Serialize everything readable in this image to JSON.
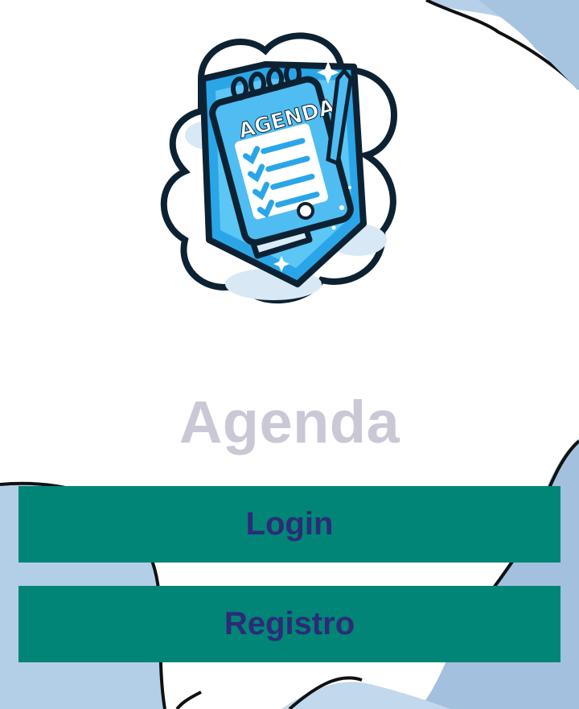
{
  "logo": {
    "text": "AGENDA",
    "icon": "agenda-notepad-logo"
  },
  "app": {
    "title": "Agenda"
  },
  "buttons": {
    "login_label": "Login",
    "register_label": "Registro"
  },
  "colors": {
    "background": "#ffffff",
    "blob": "#a9c8e4",
    "title": "#cbc8d6",
    "button_bg": "#008576",
    "button_text": "#2e2a78"
  }
}
